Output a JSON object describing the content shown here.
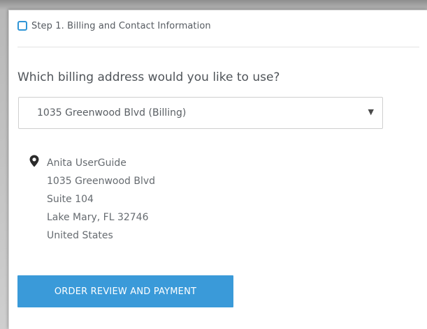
{
  "step": {
    "checked": false,
    "title": "Step 1. Billing and Contact Information"
  },
  "billing": {
    "question": "Which billing address would you like to use?",
    "selected_address": "1035 Greenwood Blvd (Billing)",
    "dropdown_icon": "caret-down-icon"
  },
  "address": {
    "icon": "map-pin-icon",
    "name": "Anita UserGuide",
    "street": "1035 Greenwood Blvd",
    "suite": "Suite 104",
    "city_state_zip": "Lake Mary, FL 32746",
    "country": "United States"
  },
  "actions": {
    "order_review_label": "ORDER REVIEW AND PAYMENT"
  },
  "colors": {
    "accent": "#3a9ad9",
    "checkbox_border": "#2f95d6",
    "text": "#555a60"
  }
}
